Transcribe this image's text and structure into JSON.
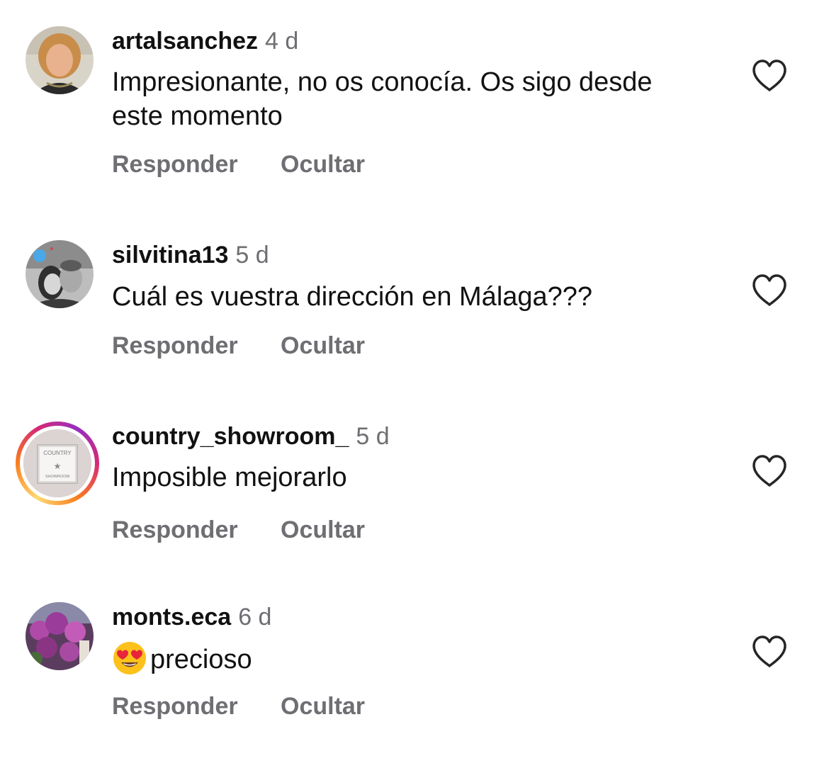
{
  "comments": [
    {
      "username": "artalsanchez",
      "time": "4 d",
      "text": "Impresionante, no os conocía. Os sigo desde este momento",
      "reply_label": "Responder",
      "hide_label": "Ocultar",
      "avatar_icon": "woman-portrait"
    },
    {
      "username": "silvitina13",
      "time": "5 d",
      "text": "Cuál es vuestra dirección en Málaga???",
      "reply_label": "Responder",
      "hide_label": "Ocultar",
      "avatar_icon": "couple-selfie"
    },
    {
      "username": "country_showroom_",
      "time": "5 d",
      "text": "Imposible mejorarlo",
      "reply_label": "Responder",
      "hide_label": "Ocultar",
      "avatar_icon": "country-showroom-logo",
      "avatar_logo_top": "COUNTRY",
      "avatar_logo_bottom": "SHOWROOM",
      "has_story_ring": true
    },
    {
      "username": "monts.eca",
      "time": "6 d",
      "text": "precioso",
      "emoji": "heart-eyes-emoji",
      "reply_label": "Responder",
      "hide_label": "Ocultar",
      "avatar_icon": "flowers-photo"
    }
  ],
  "colors": {
    "text": "#111111",
    "secondary": "#6e6e73",
    "background": "#ffffff"
  }
}
